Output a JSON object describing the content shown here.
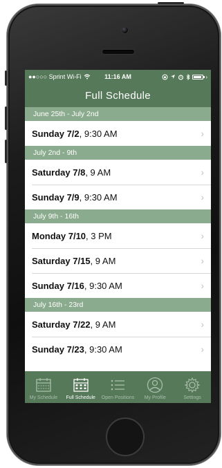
{
  "status_bar": {
    "carrier": "●●○○○ Sprint Wi-Fi",
    "time": "11:16 AM"
  },
  "nav": {
    "title": "Full Schedule"
  },
  "sections": [
    {
      "header": "June 25th - July 2nd",
      "rows": [
        {
          "day": "Sunday 7/2",
          "time": ", 9:30 AM"
        }
      ]
    },
    {
      "header": "July 2nd - 9th",
      "rows": [
        {
          "day": "Saturday 7/8",
          "time": ", 9 AM"
        },
        {
          "day": "Sunday 7/9",
          "time": ", 9:30 AM"
        }
      ]
    },
    {
      "header": "July 9th - 16th",
      "rows": [
        {
          "day": "Monday 7/10",
          "time": ", 3 PM"
        },
        {
          "day": "Saturday 7/15",
          "time": ", 9 AM"
        },
        {
          "day": "Sunday 7/16",
          "time": ", 9:30 AM"
        }
      ]
    },
    {
      "header": "July 16th - 23rd",
      "rows": [
        {
          "day": "Saturday 7/22",
          "time": ", 9 AM"
        },
        {
          "day": "Sunday 7/23",
          "time": ", 9:30 AM"
        }
      ]
    }
  ],
  "tabs": [
    {
      "label": "My Schedule",
      "icon": "calendar-week-icon",
      "active": false
    },
    {
      "label": "Full Schedule",
      "icon": "calendar-month-icon",
      "active": true
    },
    {
      "label": "Open Positions",
      "icon": "list-icon",
      "active": false
    },
    {
      "label": "My Profile",
      "icon": "profile-icon",
      "active": false
    },
    {
      "label": "Settings",
      "icon": "gear-icon",
      "active": false
    }
  ],
  "colors": {
    "bar_green": "#56795a",
    "section_green": "#8bab8e",
    "tab_inactive": "#a9bfac",
    "tab_active": "#ffffff"
  }
}
